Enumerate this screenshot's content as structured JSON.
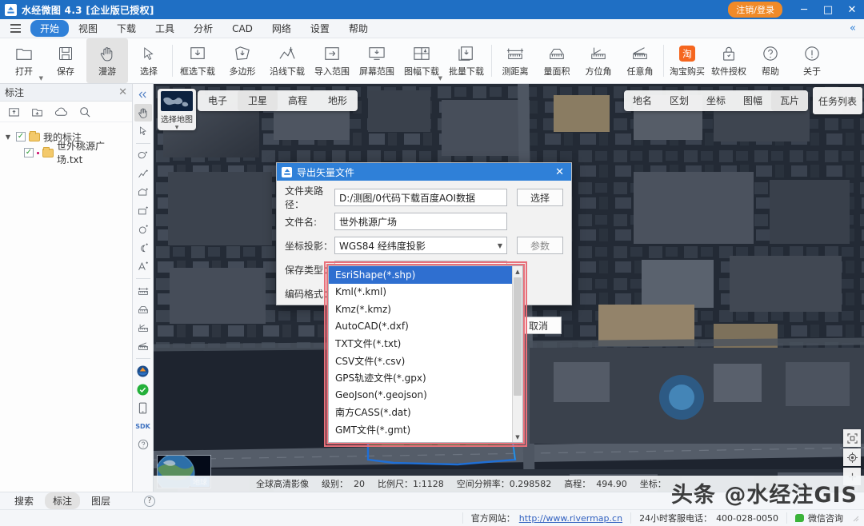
{
  "titlebar": {
    "app_title": "水经微图 4.3 [企业版已授权]",
    "login_label": "注销/登录",
    "minimize": "─",
    "maximize": "□",
    "close": "✕"
  },
  "menubar": {
    "items": [
      {
        "label": "开始",
        "active": true
      },
      {
        "label": "视图",
        "active": false
      },
      {
        "label": "下载",
        "active": false
      },
      {
        "label": "工具",
        "active": false
      },
      {
        "label": "分析",
        "active": false
      },
      {
        "label": "CAD",
        "active": false
      },
      {
        "label": "网络",
        "active": false
      },
      {
        "label": "设置",
        "active": false
      },
      {
        "label": "帮助",
        "active": false
      }
    ],
    "collapse": "«"
  },
  "ribbon": {
    "items": [
      {
        "label": "打开",
        "icon": "folder-icon",
        "caret": true
      },
      {
        "label": "保存",
        "icon": "save-icon",
        "caret": false
      },
      {
        "label": "漫游",
        "icon": "hand-icon",
        "selected": true
      },
      {
        "label": "选择",
        "icon": "cursor-icon",
        "caret": false
      },
      {
        "label": "框选下载",
        "icon": "rect-download-icon"
      },
      {
        "label": "多边形",
        "icon": "polygon-download-icon"
      },
      {
        "label": "沿线下载",
        "icon": "line-download-icon"
      },
      {
        "label": "导入范围",
        "icon": "import-range-icon"
      },
      {
        "label": "屏幕范围",
        "icon": "screen-range-icon"
      },
      {
        "label": "图幅下载",
        "icon": "grid-download-icon",
        "caret": true
      },
      {
        "label": "批量下载",
        "icon": "batch-download-icon"
      },
      {
        "label": "测距离",
        "icon": "measure-distance-icon"
      },
      {
        "label": "量面积",
        "icon": "measure-area-icon"
      },
      {
        "label": "方位角",
        "icon": "azimuth-icon"
      },
      {
        "label": "任意角",
        "icon": "angle-icon"
      },
      {
        "label": "淘宝购买",
        "icon": "taobao-icon"
      },
      {
        "label": "软件授权",
        "icon": "lock-icon"
      },
      {
        "label": "帮助",
        "icon": "question-icon"
      },
      {
        "label": "关于",
        "icon": "info-icon"
      }
    ]
  },
  "annotation_panel": {
    "title": "标注",
    "close": "✕",
    "tools": [
      "import-annotation-icon",
      "export-annotation-icon",
      "cloud-annotation-icon",
      "search-annotation-icon"
    ],
    "tree": [
      {
        "label": "我的标注",
        "checked": true,
        "level": 0,
        "expanded": true
      },
      {
        "label": "世外桃源广场.txt",
        "checked": true,
        "level": 1,
        "expanded": false
      }
    ]
  },
  "vertical_toolbar": {
    "items": [
      {
        "icon": "collapse-panel-icon",
        "selected": false
      },
      {
        "icon": "hand-pan-icon",
        "selected": true
      },
      {
        "icon": "arrow-select-icon",
        "selected": false
      },
      {
        "icon": "freehand-icon",
        "selected": false
      },
      {
        "icon": "polyline-icon",
        "selected": false
      },
      {
        "icon": "polygon-icon",
        "selected": false
      },
      {
        "icon": "rectangle-icon",
        "selected": false
      },
      {
        "icon": "circle-icon",
        "selected": false
      },
      {
        "icon": "arc-icon",
        "selected": false
      },
      {
        "icon": "text-icon",
        "selected": false
      },
      {
        "icon": "ruler-icon",
        "selected": false
      },
      {
        "icon": "area-icon",
        "selected": false
      },
      {
        "icon": "azimuth-small-icon",
        "selected": false
      },
      {
        "icon": "slope-icon",
        "selected": false
      },
      {
        "icon": "logo-round-icon",
        "selected": false
      },
      {
        "icon": "green-check-icon",
        "selected": false
      },
      {
        "icon": "mobile-icon",
        "selected": false
      },
      {
        "icon": "sdk-icon",
        "selected": false
      },
      {
        "icon": "help-round-icon",
        "selected": false
      }
    ]
  },
  "map": {
    "select_map_label": "选择地图",
    "layer_tabs": [
      {
        "label": "电子",
        "on": false
      },
      {
        "label": "卫星",
        "on": true
      },
      {
        "label": "高程",
        "on": false
      },
      {
        "label": "地形",
        "on": false
      }
    ],
    "right_tabs": [
      {
        "label": "地名",
        "on": false
      },
      {
        "label": "区划",
        "on": false
      },
      {
        "label": "坐标",
        "on": false
      },
      {
        "label": "图幅",
        "on": false
      },
      {
        "label": "瓦片",
        "on": true
      }
    ],
    "task_list_label": "任务列表",
    "controls": [
      "fit-extent-icon",
      "locate-icon",
      "zoom-in-icon"
    ],
    "globe_label": "地球",
    "status": {
      "source": "全球高清影像",
      "level_label": "级别：",
      "level_value": "20",
      "scale_label": "比例尺：",
      "scale_value": "1:1128",
      "resolution_label": "空间分辨率：",
      "resolution_value": "0.298582",
      "elevation_label": "高程：",
      "elevation_value": "494.90",
      "coord_label": "坐标："
    }
  },
  "bottom_tabs": [
    {
      "label": "搜索",
      "on": false
    },
    {
      "label": "标注",
      "on": true
    },
    {
      "label": "图层",
      "on": false
    }
  ],
  "bottom_bar": {
    "site_label": "官方网站：",
    "site_url": "http://www.rivermap.cn",
    "phone_label": "24小时客服电话：",
    "phone_value": "400-028-0050",
    "wechat_label": "微信咨询"
  },
  "dialog": {
    "title": "导出矢量文件",
    "close": "✕",
    "fields": [
      {
        "label": "文件夹路径：",
        "value": "D:/测图/0代码下载百度AOI数据",
        "button": "选择"
      },
      {
        "label": "文件名:",
        "value": "世外桃源广场",
        "button": null
      },
      {
        "label": "坐标投影：",
        "value": "WGS84 经纬度投影",
        "button": "参数",
        "select": true
      },
      {
        "label": "保存类型：",
        "value": "EsriShape(*.shp)",
        "button": null,
        "select": true
      },
      {
        "label": "编码格式：",
        "value": "",
        "button": null
      }
    ],
    "cancel_label": "取消"
  },
  "dropdown": {
    "options": [
      "EsriShape(*.shp)",
      "Kml(*.kml)",
      "Kmz(*.kmz)",
      "AutoCAD(*.dxf)",
      "TXT文件(*.txt)",
      "CSV文件(*.csv)",
      "GPS轨迹文件(*.gpx)",
      "GeoJson(*.geojson)",
      "南方CASS(*.dat)",
      "GMT文件(*.gmt)"
    ],
    "selected_index": 0,
    "scroll_up": "▲",
    "scroll_down": "▼"
  },
  "watermark": "头条 @水经注GIS",
  "colors": {
    "title_blue": "#1f6fc4",
    "accent_blue": "#2f80d8",
    "login_orange": "#f08a28",
    "highlight_red": "#e8707a",
    "selection_blue": "#2f6fd0",
    "aoi_outline": "#1f6fd6"
  }
}
